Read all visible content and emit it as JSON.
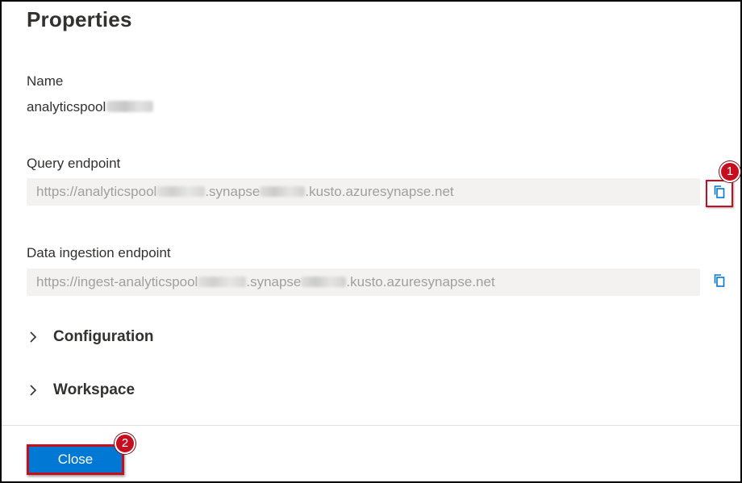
{
  "panel": {
    "title": "Properties"
  },
  "name_field": {
    "label": "Name",
    "value": "analyticspool"
  },
  "query_endpoint": {
    "label": "Query endpoint",
    "value_prefix": "https://analyticspool",
    "value_middle": ".synapse",
    "value_suffix": ".kusto.azuresynapse.net",
    "copy_icon": "copy-icon",
    "callout_number": "1"
  },
  "ingestion_endpoint": {
    "label": "Data ingestion endpoint",
    "value_prefix": "https://ingest-analyticspool",
    "value_middle": ".synapse",
    "value_suffix": ".kusto.azuresynapse.net",
    "copy_icon": "copy-icon"
  },
  "sections": [
    {
      "title": "Configuration",
      "icon": "chevron-right-icon",
      "expanded": false
    },
    {
      "title": "Workspace",
      "icon": "chevron-right-icon",
      "expanded": false
    }
  ],
  "footer": {
    "close_label": "Close",
    "callout_number": "2"
  },
  "colors": {
    "accent": "#0078d4",
    "callout": "#c50f1f",
    "field_bg": "#f3f2f1"
  }
}
